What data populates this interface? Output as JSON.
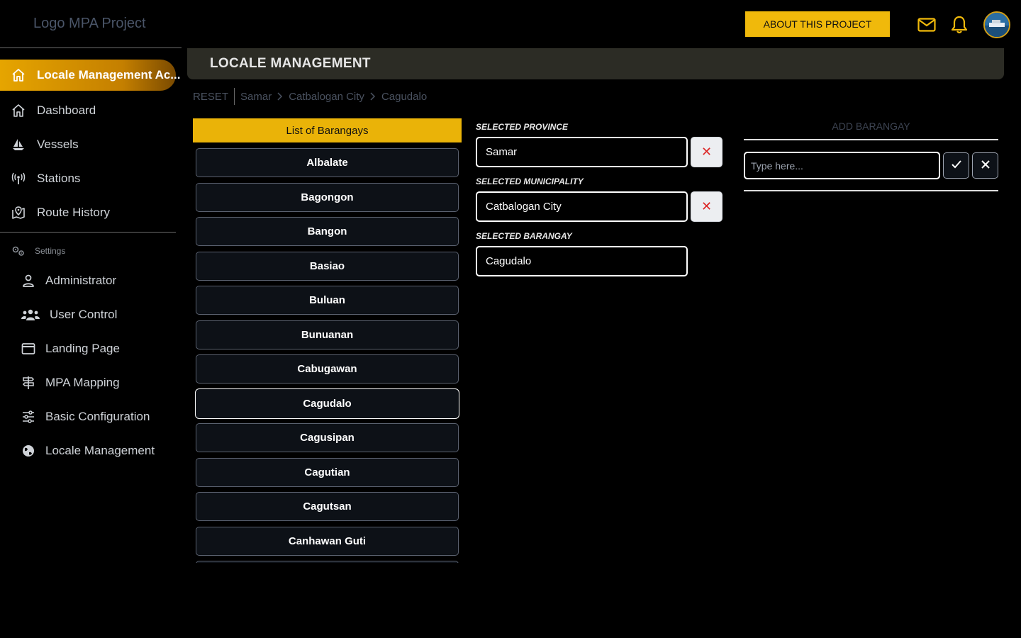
{
  "header": {
    "logo_text": "Logo MPA Project",
    "about_label": "ABOUT THIS PROJECT",
    "icons": [
      "mail-icon",
      "bell-icon"
    ]
  },
  "sidebar": {
    "active": {
      "label": "Locale Management Ac...",
      "icon": "home-icon"
    },
    "items": [
      {
        "label": "Dashboard",
        "icon": "home-icon"
      },
      {
        "label": "Vessels",
        "icon": "sailboat-icon"
      },
      {
        "label": "Stations",
        "icon": "antenna-icon"
      },
      {
        "label": "Route History",
        "icon": "map-pin-icon"
      }
    ],
    "settings_label": "Settings",
    "settings_items": [
      {
        "label": "Administrator",
        "icon": "user-icon"
      },
      {
        "label": "User Control",
        "icon": "users-icon"
      },
      {
        "label": "Landing Page",
        "icon": "window-icon"
      },
      {
        "label": "MPA Mapping",
        "icon": "signpost-icon"
      },
      {
        "label": "Basic Configuration",
        "icon": "sliders-icon"
      },
      {
        "label": "Locale Management",
        "icon": "globe-icon"
      }
    ]
  },
  "page": {
    "title": "LOCALE MANAGEMENT"
  },
  "breadcrumb": {
    "reset": "RESET",
    "crumbs": [
      "Samar",
      "Catbalogan City",
      "Cagudalo"
    ]
  },
  "barangay_list": {
    "header": "List of Barangays",
    "items": [
      "Albalate",
      "Bagongon",
      "Bangon",
      "Basiao",
      "Buluan",
      "Bunuanan",
      "Cabugawan",
      "Cagudalo",
      "Cagusipan",
      "Cagutian",
      "Cagutsan",
      "Canhawan Guti"
    ],
    "selected": "Cagudalo"
  },
  "selection": {
    "province_label": "SELECTED PROVINCE",
    "province_value": "Samar",
    "municipality_label": "SELECTED MUNICIPALITY",
    "municipality_value": "Catbalogan City",
    "barangay_label": "SELECTED BARANGAY",
    "barangay_value": "Cagudalo",
    "clear_symbol": "✕"
  },
  "add_barangay": {
    "title": "ADD BARANGAY",
    "placeholder": "Type here..."
  },
  "colors": {
    "accent": "#eab308",
    "active_nav": "#e6a500",
    "danger": "#dc2626"
  }
}
